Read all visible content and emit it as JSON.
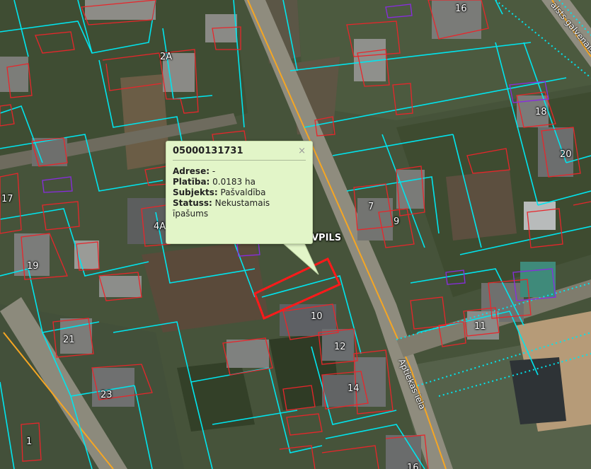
{
  "popup": {
    "title": "05000131731",
    "close_glyph": "×",
    "rows": [
      {
        "key": "Adrese:",
        "value": "-"
      },
      {
        "key": "Platība:",
        "value": "0.0183 ha"
      },
      {
        "key": "Subjekts:",
        "value": "Pašvaldība"
      },
      {
        "key": "Statuss:",
        "value": "Nekustamais īpašums"
      }
    ]
  },
  "house_numbers": [
    "16",
    "2A",
    "18",
    "20",
    "17",
    "4A",
    "7",
    "9",
    "19",
    "10",
    "12",
    "11",
    "21",
    "23",
    "14",
    "1",
    "16"
  ],
  "streets": {
    "aptiekas": "Aptiekas iela",
    "galvenais": "alsts galvenais iel"
  },
  "city_label": "VPILS",
  "colors": {
    "parcel_boundary": "#00e5ee",
    "building_outline": "#e8262b",
    "selected_parcel": "#ff1a1a",
    "road_line": "#f5a623",
    "popup_bg": "#e2f5c8",
    "purple_outline": "#8a2be2"
  }
}
